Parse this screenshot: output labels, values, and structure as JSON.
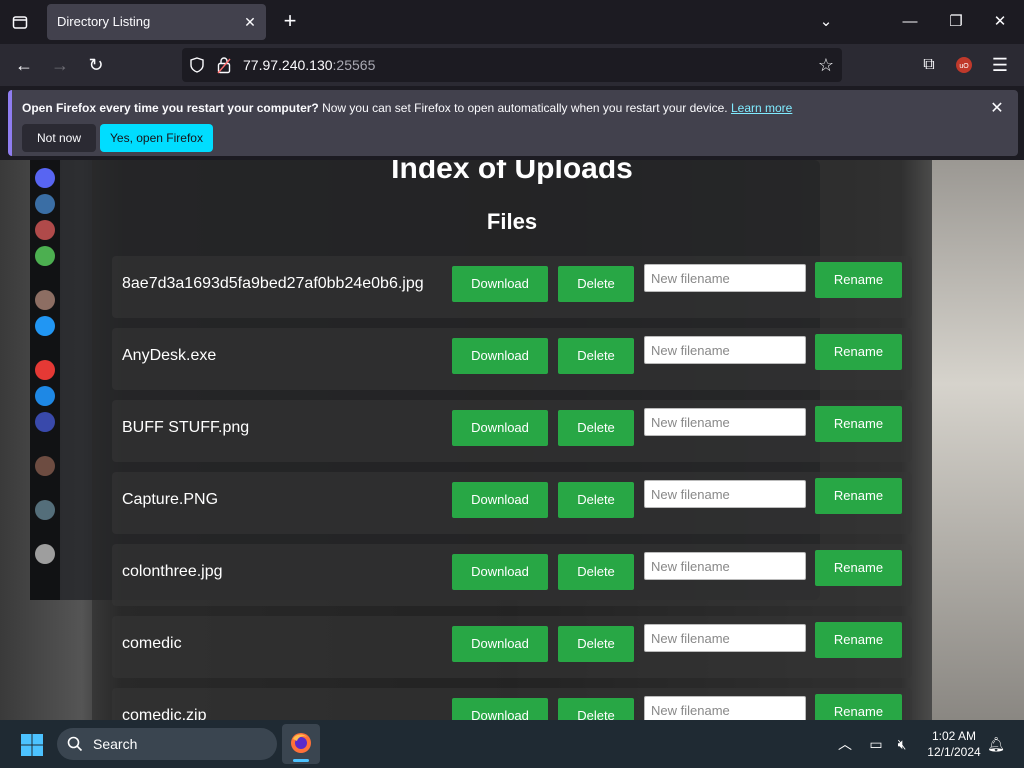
{
  "browser": {
    "tab_title": "Directory Listing",
    "url_host": "77.97.240.130",
    "url_port": ":25565"
  },
  "notification": {
    "bold_text": "Open Firefox every time you restart your computer?",
    "text": " Now you can set Firefox to open automatically when you restart your device.",
    "link": "Learn more",
    "not_now": "Not now",
    "yes": "Yes, open Firefox"
  },
  "page": {
    "title": "Index of Uploads",
    "files_heading": "Files",
    "download_label": "Download",
    "delete_label": "Delete",
    "rename_label": "Rename",
    "rename_placeholder": "New filename",
    "files": [
      "8ae7d3a1693d5fa9bed27af0bb24e0b6.jpg",
      "AnyDesk.exe",
      "BUFF STUFF.png",
      "Capture.PNG",
      "colonthree.jpg",
      "comedic",
      "comedic.zip"
    ]
  },
  "taskbar": {
    "search": "Search",
    "time": "1:02 AM",
    "date": "12/1/2024"
  }
}
